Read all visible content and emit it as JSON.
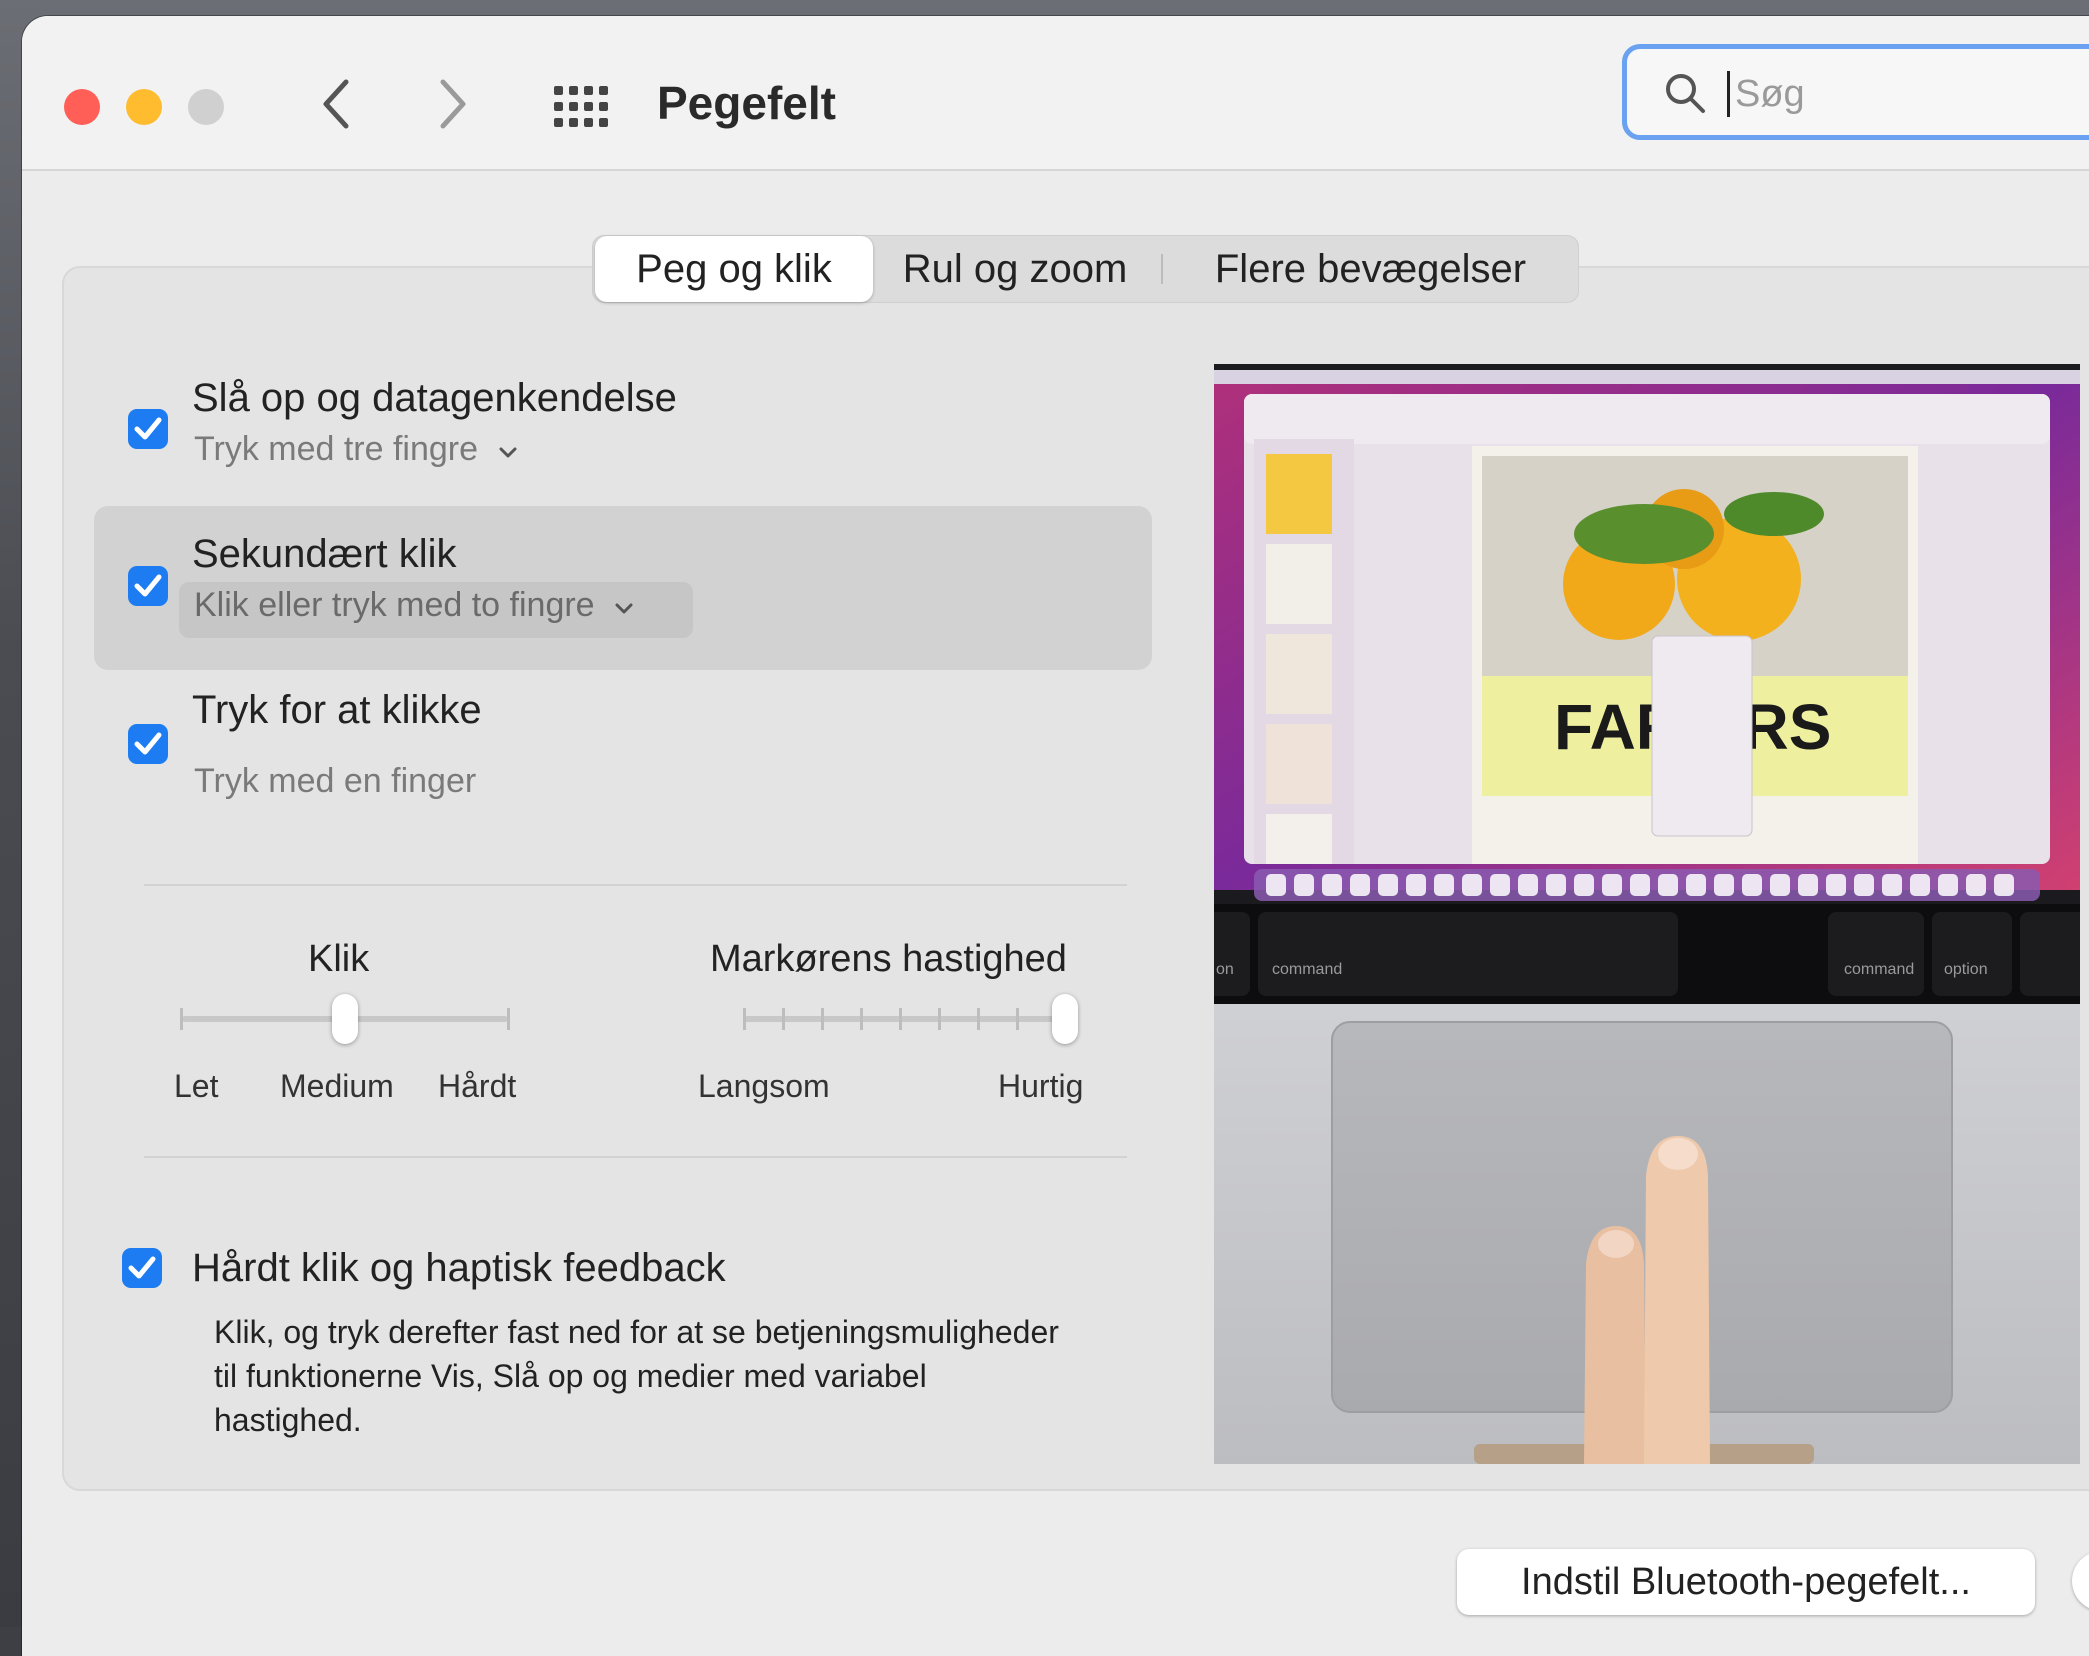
{
  "window": {
    "title": "Pegefelt"
  },
  "toolbar": {
    "back_icon": "chevron-left-icon",
    "forward_icon": "chevron-right-icon",
    "grid_icon": "grid-icon"
  },
  "search": {
    "placeholder": "Søg",
    "value": ""
  },
  "tabs": [
    {
      "label": "Peg og klik",
      "active": true
    },
    {
      "label": "Rul og zoom",
      "active": false
    },
    {
      "label": "Flere bevægelser",
      "active": false
    }
  ],
  "options": {
    "lookup": {
      "title": "Slå op og datagenkendelse",
      "sub": "Tryk med tre fingre",
      "checked": true
    },
    "secondary": {
      "title": "Sekundært klik",
      "sub": "Klik eller tryk med to fingre",
      "checked": true
    },
    "tap": {
      "title": "Tryk for at klikke",
      "sub": "Tryk med en finger",
      "checked": true
    },
    "force": {
      "title": "Hårdt klik og haptisk feedback",
      "checked": true,
      "desc": "Klik, og tryk derefter fast ned for at se betjeningsmuligheder til funktionerne Vis, Slå op og medier med variabel hastighed."
    }
  },
  "click_slider": {
    "label": "Klik",
    "min_label": "Let",
    "mid_label": "Medium",
    "max_label": "Hårdt",
    "value": "Medium"
  },
  "speed_slider": {
    "label": "Markørens hastighed",
    "min_label": "Langsom",
    "max_label": "Hurtig",
    "value_fraction": 1.0
  },
  "preview": {
    "keys": {
      "command": "command",
      "option": "option",
      "on": "on"
    },
    "poster_text": "FAR ERS"
  },
  "buttons": {
    "bluetooth": "Indstil Bluetooth-pegefelt...",
    "help": "?"
  },
  "colors": {
    "accent": "#1d7cf2",
    "close": "#ff5f57",
    "minimize": "#febc2e",
    "search_focus": "#6aa1f0"
  }
}
